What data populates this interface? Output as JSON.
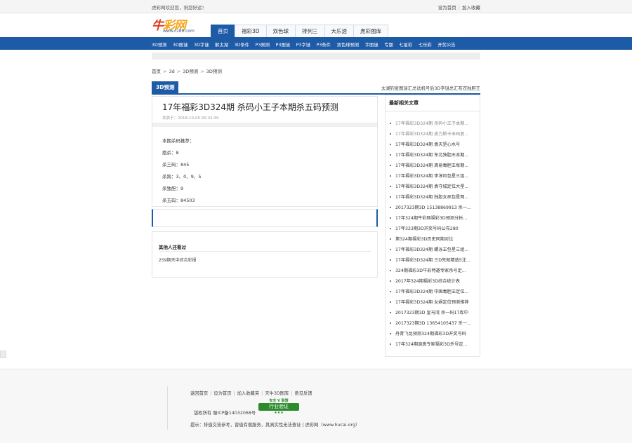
{
  "topbar": {
    "welcome": "虎彩网欢迎您，祝您好运！",
    "set_home": "设为首页",
    "add_fav": "加入收藏"
  },
  "logo": {
    "brand_part1": "牛",
    "brand_part2": "彩网",
    "domain": "www.cz89.com"
  },
  "mainnav": [
    "首页",
    "福彩3D",
    "双色球",
    "排列三",
    "大乐透",
    "虎彩图库"
  ],
  "subnav": [
    "3D预测",
    "3D图谜",
    "3D字谜",
    "解太湖",
    "3D条件",
    "P3预测",
    "P3图谜",
    "P3字谜",
    "P3条件",
    "双色球预测",
    "字图谜",
    "专题",
    "七星彩",
    "七乐彩",
    "开奖公告"
  ],
  "breadcrumb": [
    "首页",
    "3d",
    "3D预测",
    "3D预测"
  ],
  "section": {
    "tab": "3D预测",
    "tabs": [
      "太湖钓叟",
      "图谜汇总",
      "试机号后",
      "3D字谜总汇",
      "布衣独胆王"
    ]
  },
  "article": {
    "title": "17年福彩3D324期 杀码小王子本期杀五码预测",
    "date": "发表于：2018-10-05 00:32:39",
    "lines": [
      "本期杀码推荐：",
      "绝杀：8",
      "杀三码：845",
      "杀跨：3、0、9、5",
      "杀独胆：9",
      "杀五码：84503"
    ]
  },
  "others": {
    "title": "其他人还看过",
    "items": [
      "259期天中综合彩报"
    ]
  },
  "sidebar": {
    "title": "最新相关文章",
    "items": [
      "17年福彩3D324期 杀码小王子本期...",
      "17年福彩3D324期 皮力斯卡五码复...",
      "17年福彩3D324期 袁天罡心水号",
      "17年福彩3D324期 东北独胆王本期...",
      "17年福彩3D324期 周易毒胆王每期...",
      "17年福彩3D324期 李淳风包星三组...",
      "17年福彩3D324期 袁守城定位大星...",
      "17年福彩3D324期 独胆女巫包星两...",
      "2017323期3D 15138869913 杀一...",
      "17年324期牛彩网福彩3D预测分析...",
      "17年323期3D开奖号码公布280",
      "第324期福彩3D历史同期对比",
      "17年福彩3D324期 螺泳王包星三组...",
      "17年福彩3D324期 三D先知精选5注...",
      "324期福彩3D牛彩特邀专家杀号定...",
      "2017年324期福彩3D综合统计表",
      "17年福彩3D324期 中国毒胆王定位...",
      "17年福彩3D324期 女娲定位预测推荐",
      "2017323期3D 皇马湾 杀一码17库中",
      "2017323期3D 13654105437 杀一...",
      "丹青飞龙预测324期福彩3D开奖号码",
      "17年324期调鼻专家福彩3D杀号定..."
    ]
  },
  "footer": {
    "links": [
      "返回首页",
      "设为首页",
      "加入收藏夹",
      "天牛3D图库",
      "意见反馈"
    ],
    "icp": "版权所有  蜀ICP备14032068号",
    "badge_top": "安全 V 联盟",
    "badge_main": "行业验证",
    "badge_stars": "★★★",
    "tip": "提示：排值交流参考，曾值有偿服务，其真实性无法查证 | 虎彩网（www.hucai.org）"
  }
}
